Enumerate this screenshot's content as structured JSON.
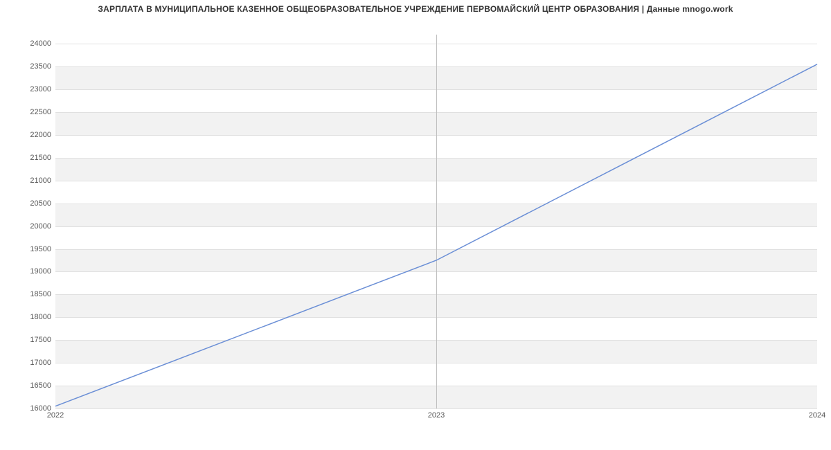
{
  "chart_data": {
    "type": "line",
    "title": "ЗАРПЛАТА В МУНИЦИПАЛЬНОЕ КАЗЕННОЕ ОБЩЕОБРАЗОВАТЕЛЬНОЕ УЧРЕЖДЕНИЕ ПЕРВОМАЙСКИЙ ЦЕНТР ОБРАЗОВАНИЯ | Данные mnogo.work",
    "x": [
      2022,
      2023,
      2024
    ],
    "values": [
      16050,
      19250,
      23550
    ],
    "x_ticks": [
      "2022",
      "2023",
      "2024"
    ],
    "y_ticks": [
      16000,
      16500,
      17000,
      17500,
      18000,
      18500,
      19000,
      19500,
      20000,
      20500,
      21000,
      21500,
      22000,
      22500,
      23000,
      23500,
      24000
    ],
    "ylim": [
      16000,
      24200
    ],
    "xlim": [
      2022,
      2024
    ],
    "xlabel": "",
    "ylabel": "",
    "grid": true
  }
}
